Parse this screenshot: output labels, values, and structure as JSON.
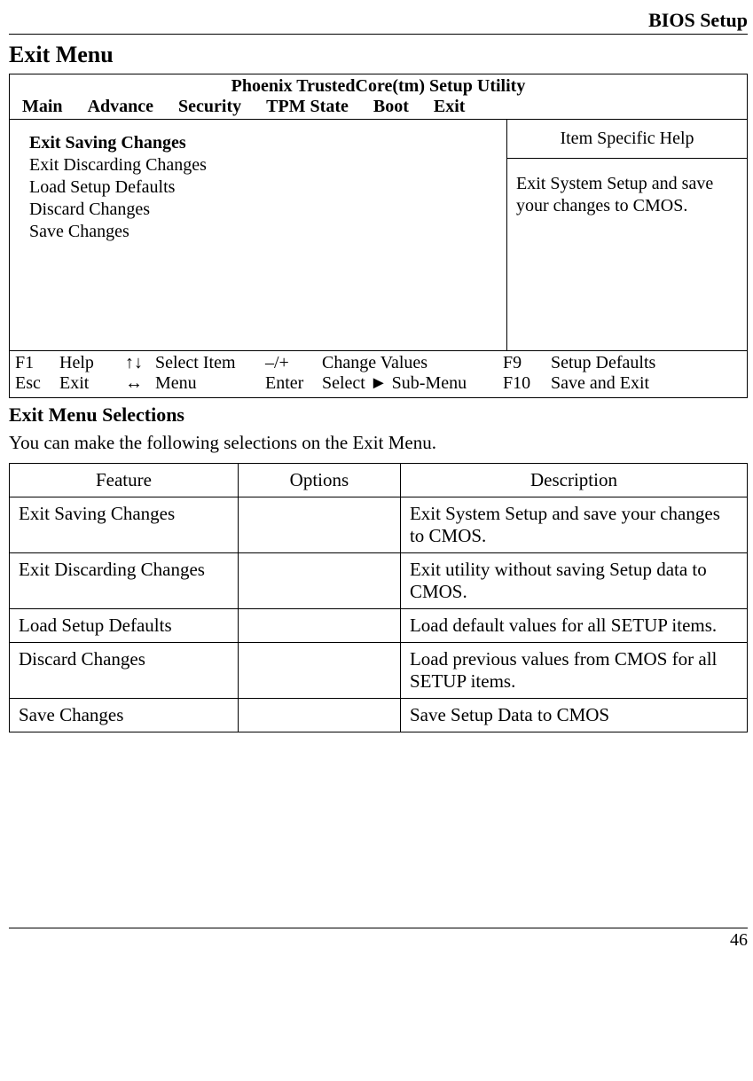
{
  "header": {
    "right": "BIOS Setup"
  },
  "section_title": "Exit Menu",
  "bios": {
    "title": "Phoenix TrustedCore(tm) Setup Utility",
    "tabs": [
      "Main",
      "Advance",
      "Security",
      "TPM State",
      "Boot",
      "Exit"
    ],
    "menu_items": [
      "Exit Saving Changes",
      "Exit Discarding Changes",
      "Load Setup Defaults",
      "Discard Changes",
      "Save Changes"
    ],
    "help_title": "Item Specific Help",
    "help_body": "Exit System Setup and save your changes to CMOS.",
    "footer": {
      "r1": {
        "k1": "F1",
        "l1": "Help",
        "k2": "↑↓",
        "l2": "Select Item",
        "k3": "–/+",
        "l3": "Change Values",
        "k4": "F9",
        "l4": "Setup Defaults"
      },
      "r2": {
        "k1": "Esc",
        "l1": "Exit",
        "k2": "↔",
        "l2": "Menu",
        "k3": "Enter",
        "l3": "Select ► Sub-Menu",
        "k4": "F10",
        "l4": "Save and Exit"
      }
    }
  },
  "sub_title": "Exit Menu Selections",
  "intro": "You can make the following selections on the Exit Menu.",
  "table": {
    "headers": [
      "Feature",
      "Options",
      "Description"
    ],
    "rows": [
      {
        "feature": "Exit Saving Changes",
        "options": "",
        "description": "Exit System Setup and save your changes to CMOS."
      },
      {
        "feature": "Exit Discarding Changes",
        "options": "",
        "description": "Exit utility without saving Setup data to CMOS."
      },
      {
        "feature": "Load Setup Defaults",
        "options": "",
        "description": "Load default values for all SETUP items."
      },
      {
        "feature": "Discard Changes",
        "options": "",
        "description": "Load previous values from CMOS for all SETUP items."
      },
      {
        "feature": "Save Changes",
        "options": "",
        "description": "Save Setup Data to CMOS"
      }
    ]
  },
  "page_number": "46"
}
